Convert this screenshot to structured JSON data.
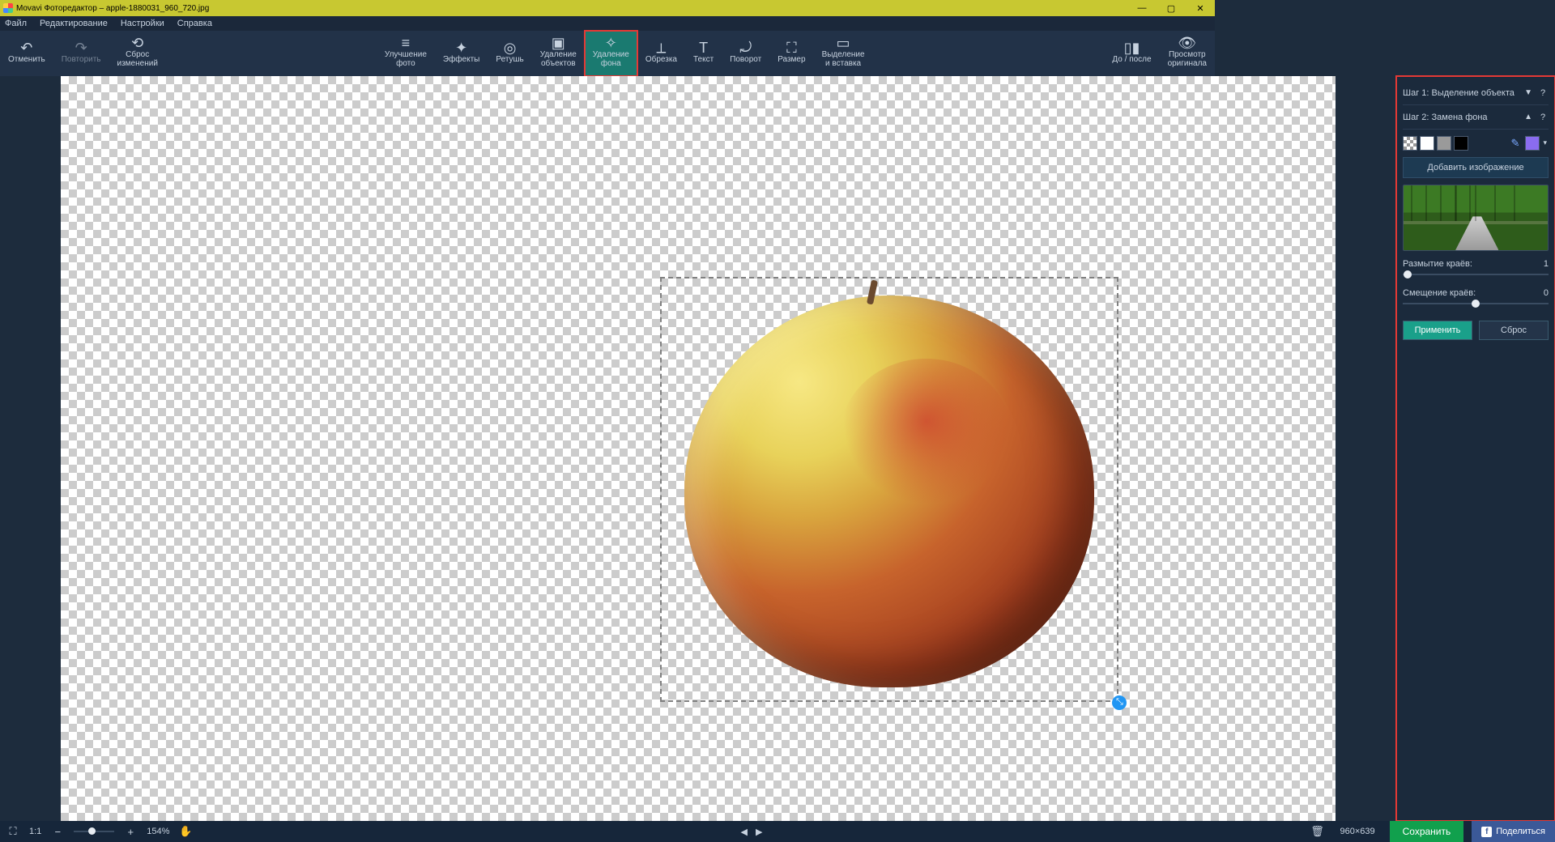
{
  "window": {
    "title": "Movavi Фоторедактор – apple-1880031_960_720.jpg"
  },
  "menu": {
    "file": "Файл",
    "edit": "Редактирование",
    "settings": "Настройки",
    "help": "Справка"
  },
  "toolbar": {
    "undo": "Отменить",
    "redo": "Повторить",
    "reset": "Сброс\nизменений",
    "enhance": "Улучшение\nфото",
    "effects": "Эффекты",
    "retouch": "Ретушь",
    "remove_obj": "Удаление\nобъектов",
    "remove_bg": "Удаление\nфона",
    "crop": "Обрезка",
    "text": "Текст",
    "rotate": "Поворот",
    "resize": "Размер",
    "copy_paste": "Выделение\nи вставка",
    "before_after": "До / после",
    "view_orig": "Просмотр\nоригинала"
  },
  "panel": {
    "step1": "Шаг 1: Выделение объекта",
    "step2": "Шаг 2: Замена фона",
    "add_image": "Добавить изображение",
    "blur_label": "Размытие краёв:",
    "blur_value": "1",
    "shift_label": "Смещение краёв:",
    "shift_value": "0",
    "apply": "Применить",
    "reset": "Сброс"
  },
  "status": {
    "scale_1to1": "1:1",
    "zoom": "154%",
    "dims": "960×639",
    "save": "Сохранить",
    "share": "Поделиться"
  }
}
